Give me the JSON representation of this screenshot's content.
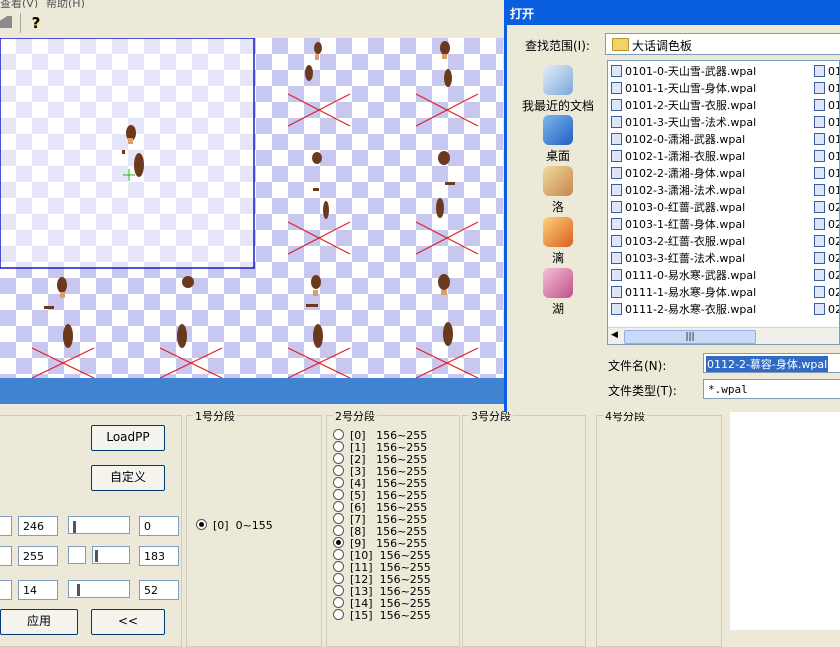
{
  "menu": {
    "view": "查看(V)",
    "help": "帮助(H)"
  },
  "toolbar": {
    "help_glyph": "?"
  },
  "panel": {
    "load_button": "LoadPP",
    "custom_button": "自定义",
    "apply_button": "应用",
    "back_button": "<<",
    "values_left": [
      "246",
      "255",
      "14"
    ],
    "values_right": [
      "0",
      "183",
      "52"
    ],
    "group1": {
      "title": "1号分段",
      "items": [
        {
          "label": "[0]  0~155",
          "checked": true
        }
      ]
    },
    "group2": {
      "title": "2号分段",
      "items": [
        {
          "label": "[0]   156~255",
          "checked": false
        },
        {
          "label": "[1]   156~255",
          "checked": false
        },
        {
          "label": "[2]   156~255",
          "checked": false
        },
        {
          "label": "[3]   156~255",
          "checked": false
        },
        {
          "label": "[4]   156~255",
          "checked": false
        },
        {
          "label": "[5]   156~255",
          "checked": false
        },
        {
          "label": "[6]   156~255",
          "checked": false
        },
        {
          "label": "[7]   156~255",
          "checked": false
        },
        {
          "label": "[8]   156~255",
          "checked": false
        },
        {
          "label": "[9]   156~255",
          "checked": true
        },
        {
          "label": "[10]  156~255",
          "checked": false
        },
        {
          "label": "[11]  156~255",
          "checked": false
        },
        {
          "label": "[12]  156~255",
          "checked": false
        },
        {
          "label": "[13]  156~255",
          "checked": false
        },
        {
          "label": "[14]  156~255",
          "checked": false
        },
        {
          "label": "[15]  156~255",
          "checked": false
        }
      ]
    },
    "group3": {
      "title": "3号分段"
    },
    "group4": {
      "title": "4号分段"
    }
  },
  "dialog": {
    "title": "打开",
    "lookin_label": "查找范围(I):",
    "lookin_value": "大话调色板",
    "places": [
      "我最近的文档",
      "桌面",
      "洛",
      "漓",
      "湖"
    ],
    "files": [
      "0101-0-天山雪-武器.wpal",
      "0101-1-天山雪-身体.wpal",
      "0101-2-天山雪-衣服.wpal",
      "0101-3-天山雪-法术.wpal",
      "0102-0-潇湘-武器.wpal",
      "0102-1-潇湘-衣服.wpal",
      "0102-2-潇湘-身体.wpal",
      "0102-3-潇湘-法术.wpal",
      "0103-0-红蔷-武器.wpal",
      "0103-1-红蔷-身体.wpal",
      "0103-2-红蔷-衣服.wpal",
      "0103-3-红蔷-法术.wpal",
      "0111-0-易水寒-武器.wpal",
      "0111-1-易水寒-身体.wpal",
      "0111-2-易水寒-衣服.wpal"
    ],
    "files_col2": [
      "01",
      "01",
      "01",
      "01",
      "01",
      "01",
      "01",
      "01",
      "02",
      "02",
      "02",
      "02",
      "02",
      "02",
      "02"
    ],
    "scroll_thumb": "|||",
    "filename_label": "文件名(N):",
    "filename_value": "0112-2-慕容-身体.wpal",
    "filetype_label": "文件类型(T):",
    "filetype_value": "*.wpal"
  }
}
